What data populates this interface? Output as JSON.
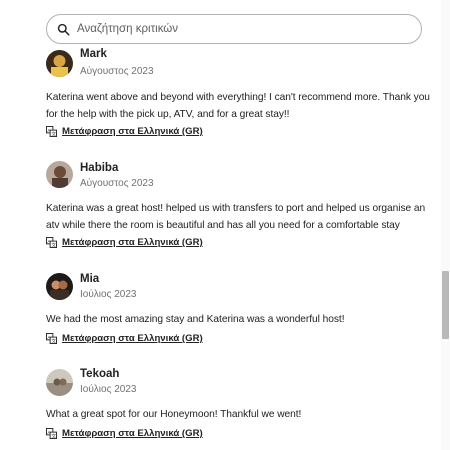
{
  "search": {
    "placeholder": "Αναζήτηση κριτικών",
    "value": ""
  },
  "reviews": [
    {
      "name": "Mark",
      "date": "Αύγουστος 2023",
      "text_lines": [
        "Katerina went above and beyond with everything! I can't recommend more. Thank you",
        "for the help with the pick up, ATV, and for a great stay!!"
      ],
      "translate_label": "Μετάφραση στα Ελληνικά (GR)"
    },
    {
      "name": "Habiba",
      "date": "Αύγουστος 2023",
      "text_lines": [
        "Katerina was a great host! helped us with transfers to port and helped us organise an",
        "atv while there the room is beautiful and has all you need for a comfortable stay"
      ],
      "translate_label": "Μετάφραση στα Ελληνικά (GR)"
    },
    {
      "name": "Mia",
      "date": "Ιούλιος 2023",
      "text_lines": [
        "We had the most amazing stay and Katerina was a wonderful host!"
      ],
      "translate_label": "Μετάφραση στα Ελληνικά (GR)"
    },
    {
      "name": "Tekoah",
      "date": "Ιούλιος 2023",
      "text_lines": [
        "What a great spot for our Honeymoon! Thankful we went!"
      ],
      "translate_label": "Μετάφραση στα Ελληνικά (GR)"
    }
  ],
  "icons": {
    "search": "search-icon",
    "translate": "translate-icon"
  }
}
